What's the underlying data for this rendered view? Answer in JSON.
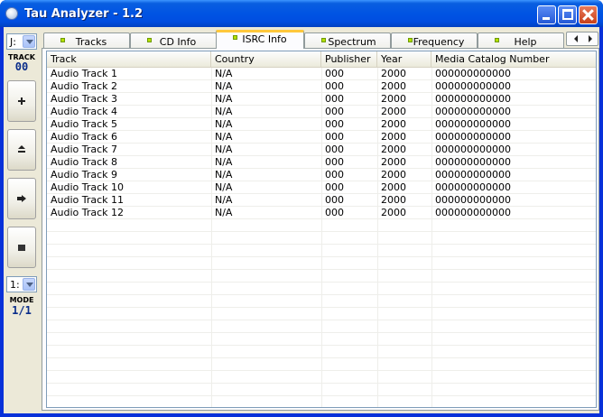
{
  "window": {
    "title": "Tau Analyzer - 1.2"
  },
  "toolbar": {
    "drive_select": "J:",
    "track_caption": "TRACK",
    "track_number": "00",
    "buttons": [
      "add",
      "eject",
      "next",
      "stop"
    ],
    "mode_select": "1:",
    "mode_caption": "MODE",
    "mode_value": "1/1"
  },
  "tabs": [
    {
      "label": "Tracks",
      "active": false
    },
    {
      "label": "CD Info",
      "active": false
    },
    {
      "label": "ISRC Info",
      "active": true
    },
    {
      "label": "Spectrum",
      "active": false
    },
    {
      "label": "Frequency",
      "active": false
    },
    {
      "label": "Help",
      "active": false
    }
  ],
  "table": {
    "columns": [
      "Track",
      "Country",
      "Publisher",
      "Year",
      "Media Catalog Number"
    ],
    "rows": [
      [
        "Audio Track 1",
        "N/A",
        "000",
        "2000",
        "000000000000"
      ],
      [
        "Audio Track 2",
        "N/A",
        "000",
        "2000",
        "000000000000"
      ],
      [
        "Audio Track 3",
        "N/A",
        "000",
        "2000",
        "000000000000"
      ],
      [
        "Audio Track 4",
        "N/A",
        "000",
        "2000",
        "000000000000"
      ],
      [
        "Audio Track 5",
        "N/A",
        "000",
        "2000",
        "000000000000"
      ],
      [
        "Audio Track 6",
        "N/A",
        "000",
        "2000",
        "000000000000"
      ],
      [
        "Audio Track 7",
        "N/A",
        "000",
        "2000",
        "000000000000"
      ],
      [
        "Audio Track 8",
        "N/A",
        "000",
        "2000",
        "000000000000"
      ],
      [
        "Audio Track 9",
        "N/A",
        "000",
        "2000",
        "000000000000"
      ],
      [
        "Audio Track 10",
        "N/A",
        "000",
        "2000",
        "000000000000"
      ],
      [
        "Audio Track 11",
        "N/A",
        "000",
        "2000",
        "000000000000"
      ],
      [
        "Audio Track 12",
        "N/A",
        "000",
        "2000",
        "000000000000"
      ]
    ]
  },
  "colors": {
    "titlebar": "#0054e3",
    "active_tab_accent": "#ffc83c",
    "tab_marker": "#b6e000",
    "counter_text": "#0a2d8a"
  }
}
